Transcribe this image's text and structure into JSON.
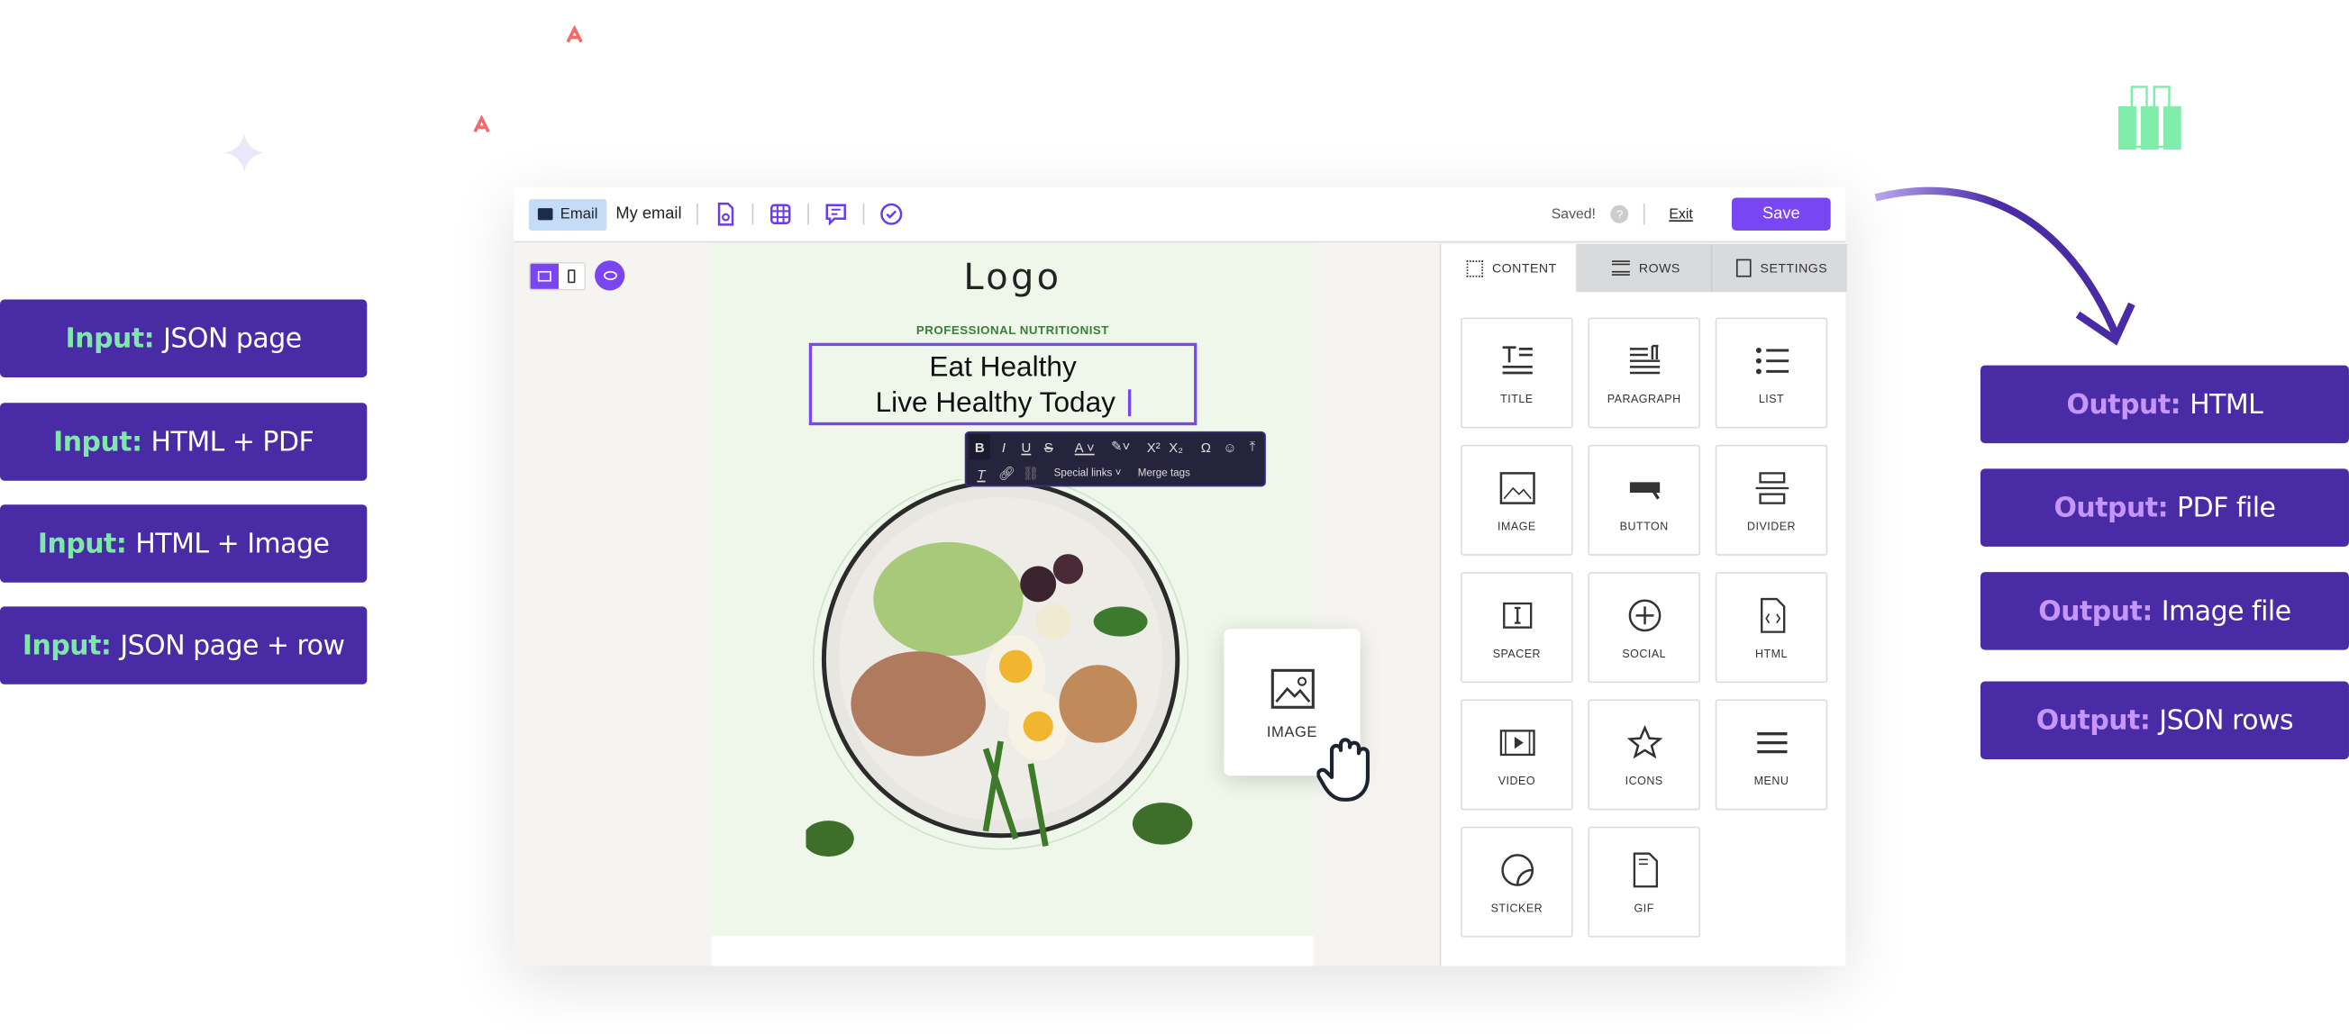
{
  "inputs": [
    {
      "key": "Input:",
      "value": "JSON page"
    },
    {
      "key": "Input:",
      "value": "HTML + PDF"
    },
    {
      "key": "Input:",
      "value": "HTML + Image"
    },
    {
      "key": "Input:",
      "value": "JSON page + row"
    }
  ],
  "outputs": [
    {
      "key": "Output:",
      "value": "HTML"
    },
    {
      "key": "Output:",
      "value": "PDF file"
    },
    {
      "key": "Output:",
      "value": "Image file"
    },
    {
      "key": "Output:",
      "value": "JSON rows"
    }
  ],
  "topbar": {
    "type_label": "Email",
    "name": "My email",
    "status": "Saved!",
    "help": "?",
    "exit": "Exit",
    "save": "Save"
  },
  "tabs": [
    "CONTENT",
    "ROWS",
    "SETTINGS"
  ],
  "tiles": [
    "TITLE",
    "PARAGRAPH",
    "LIST",
    "IMAGE",
    "BUTTON",
    "DIVIDER",
    "SPACER",
    "SOCIAL",
    "HTML",
    "VIDEO",
    "ICONS",
    "MENU",
    "STICKER",
    "GIF"
  ],
  "email": {
    "logo": "Logo",
    "eyebrow": "PROFESSIONAL NUTRITIONIST",
    "headline1": "Eat Healthy",
    "headline2": "Live Healthy Today"
  },
  "text_toolbar": {
    "bold": "B",
    "italic": "I",
    "underline": "U",
    "strike": "S",
    "superscript": "X²",
    "subscript": "X₂",
    "omega": "Ω",
    "special_links": "Special links",
    "merge_tags": "Merge tags"
  },
  "drag_card": {
    "label": "IMAGE"
  },
  "colors": {
    "accent": "#7a45f2",
    "pill": "#4a2ba6",
    "input_key": "#7ee8aa",
    "output_key": "#c596ff",
    "email_bg": "#eef7ea"
  }
}
